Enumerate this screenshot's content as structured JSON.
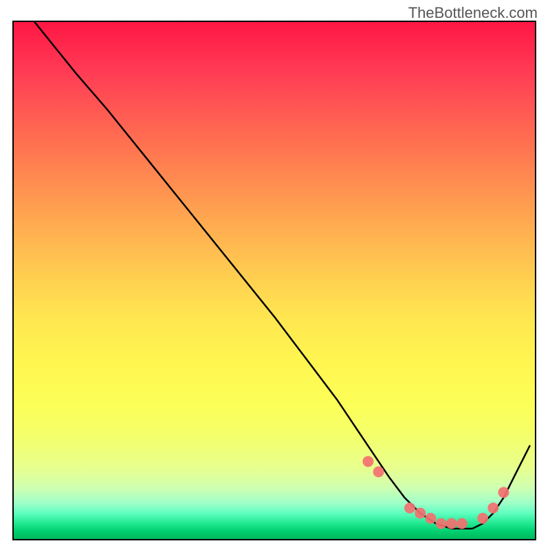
{
  "watermark": "TheBottleneck.com",
  "chart_data": {
    "type": "line",
    "title": "",
    "xlabel": "",
    "ylabel": "",
    "xlim": [
      0,
      100
    ],
    "ylim": [
      0,
      100
    ],
    "curve": {
      "x": [
        4,
        8,
        12,
        18,
        26,
        34,
        42,
        50,
        56,
        62,
        66,
        68,
        70,
        72,
        75,
        78,
        81,
        84,
        86,
        88,
        90,
        92,
        94,
        96,
        99
      ],
      "y": [
        100,
        95,
        90,
        83,
        73,
        63,
        53,
        43,
        35,
        27,
        21,
        18,
        15,
        12,
        8,
        5,
        3,
        2,
        2,
        2,
        3,
        5,
        8,
        12,
        18
      ]
    },
    "markers": {
      "x": [
        68,
        70,
        76,
        78,
        80,
        82,
        84,
        86,
        90,
        92,
        94
      ],
      "y": [
        15,
        13,
        6,
        5,
        4,
        3,
        3,
        3,
        4,
        6,
        9
      ]
    },
    "gradient_colors": {
      "top": "#ff1744",
      "mid": "#fff650",
      "bottom": "#00b85c"
    }
  }
}
